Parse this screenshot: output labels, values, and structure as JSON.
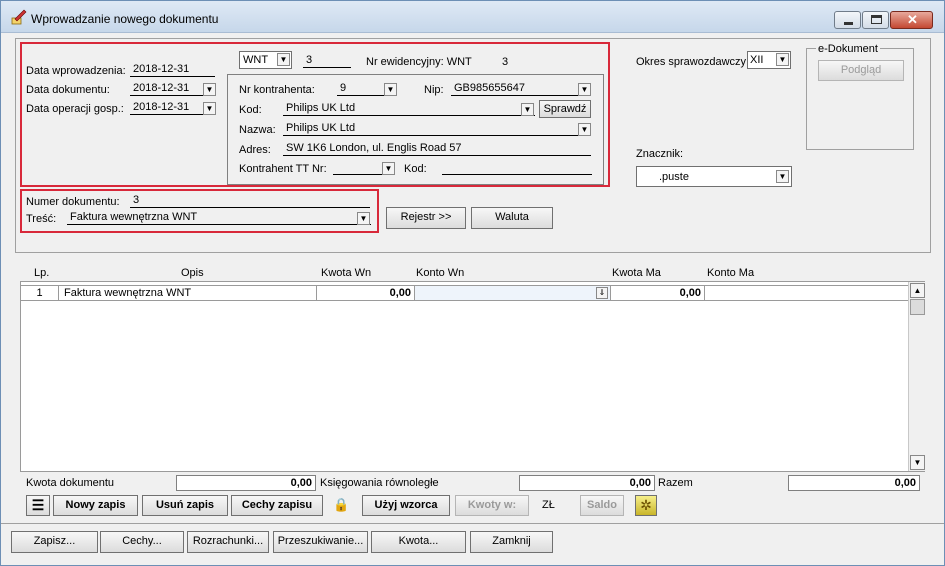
{
  "window": {
    "title": "Wprowadzanie nowego dokumentu"
  },
  "dates": {
    "entry_label": "Data wprowadzenia:",
    "entry_value": "2018-12-31",
    "doc_label": "Data dokumentu:",
    "doc_value": "2018-12-31",
    "op_label": "Data operacji gosp.:",
    "op_value": "2018-12-31"
  },
  "doc_type": {
    "value": "WNT",
    "number": "3",
    "reg_label": "Nr ewidencyjny: WNT",
    "reg_number": "3"
  },
  "contractor": {
    "nr_label": "Nr kontrahenta:",
    "nr_value": "9",
    "nip_label": "Nip:",
    "nip_value": "GB985655647",
    "code_label": "Kod:",
    "code_value": "Philips UK Ltd",
    "check_btn": "Sprawdź",
    "name_label": "Nazwa:",
    "name_value": "Philips UK Ltd",
    "address_label": "Adres:",
    "address_value": "SW 1K6 London, ul. Englis Road 57",
    "tt_label": "Kontrahent TT Nr:",
    "tt_value": "",
    "tt_code_label": "Kod:",
    "tt_code_value": ""
  },
  "period": {
    "label": "Okres sprawozdawczy:",
    "value": "XII"
  },
  "edoc": {
    "legend": "e-Dokument",
    "preview_btn": "Podgląd"
  },
  "marker": {
    "label": "Znacznik:",
    "value": ".puste"
  },
  "document": {
    "number_label": "Numer dokumentu:",
    "number_value": "3",
    "content_label": "Treść:",
    "content_value": "Faktura wewnętrzna WNT"
  },
  "actions": {
    "register_btn": "Rejestr >>",
    "currency_btn": "Waluta"
  },
  "table": {
    "columns": [
      "Lp.",
      "Opis",
      "Kwota Wn",
      "Konto Wn",
      "Kwota Ma",
      "Konto Ma"
    ],
    "rows": [
      {
        "lp": "1",
        "opis": "Faktura wewnętrzna WNT",
        "kwota_wn": "0,00",
        "konto_wn": "",
        "kwota_ma": "0,00",
        "konto_ma": ""
      }
    ]
  },
  "totals": {
    "doc_label": "Kwota dokumentu",
    "doc_value": "0,00",
    "parallel_label": "Księgowania równoległe",
    "parallel_value": "0,00",
    "sum_label": "Razem",
    "sum_value": "0,00"
  },
  "toolbar": {
    "new_entry": "Nowy zapis",
    "delete_entry": "Usuń zapis",
    "entry_features": "Cechy zapisu",
    "use_template": "Użyj wzorca",
    "amounts": "Kwoty w:",
    "currency": "ZŁ",
    "balance": "Saldo"
  },
  "bottom": {
    "save": "Zapisz...",
    "features": "Cechy...",
    "settlements": "Rozrachunki...",
    "search": "Przeszukiwanie...",
    "amount": "Kwota...",
    "close": "Zamknij"
  }
}
